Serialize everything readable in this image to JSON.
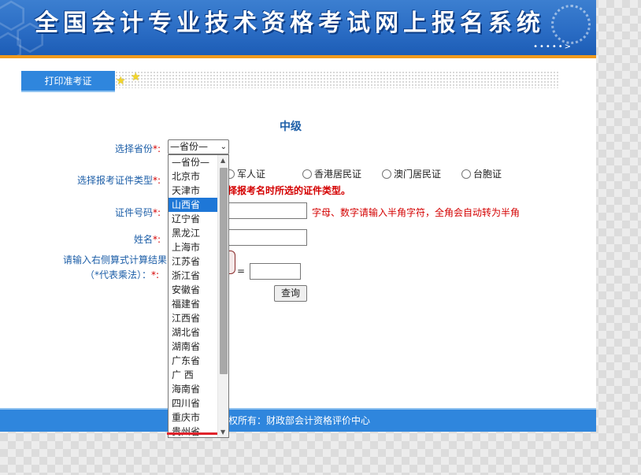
{
  "banner": {
    "title": "全国会计专业技术资格考试网上报名系统"
  },
  "nav": {
    "print_tab": "打印准考证"
  },
  "form": {
    "heading": "中级",
    "province_label": "选择省份",
    "province_selected": "—省份—",
    "id_type_label": "选择报考证件类型",
    "id_type_options": [
      "军人证",
      "香港居民证",
      "澳门居民证",
      "台胞证"
    ],
    "id_type_warning": "择报考名时所选的证件类型。",
    "id_number_label": "证件号码",
    "id_number_hint": "字母、数字请输入半角字符，全角会自动转为半角",
    "name_label": "姓名",
    "captcha_label_line1": "请输入右侧算式计算结果",
    "captcha_label_line2": "（*代表乘法）：",
    "required_mark": "*:",
    "equals": "=",
    "query_button": "查询"
  },
  "province_dropdown": {
    "selected_index": 3,
    "options": [
      "—省份—",
      "北京市",
      "天津市",
      "山西省",
      "辽宁省",
      "黑龙江",
      "上海市",
      "江苏省",
      "浙江省",
      "安徽省",
      "福建省",
      "江西省",
      "湖北省",
      "湖南省",
      "广东省",
      "广 西",
      "海南省",
      "四川省",
      "重庆市",
      "贵州省"
    ]
  },
  "footer": {
    "text": "权所有：财政部会计资格评价中心"
  },
  "colors": {
    "accent_blue": "#2f86dd",
    "label_blue": "#1e5fa8",
    "warning_red": "#d40000",
    "highlight": "#1e77d7"
  }
}
